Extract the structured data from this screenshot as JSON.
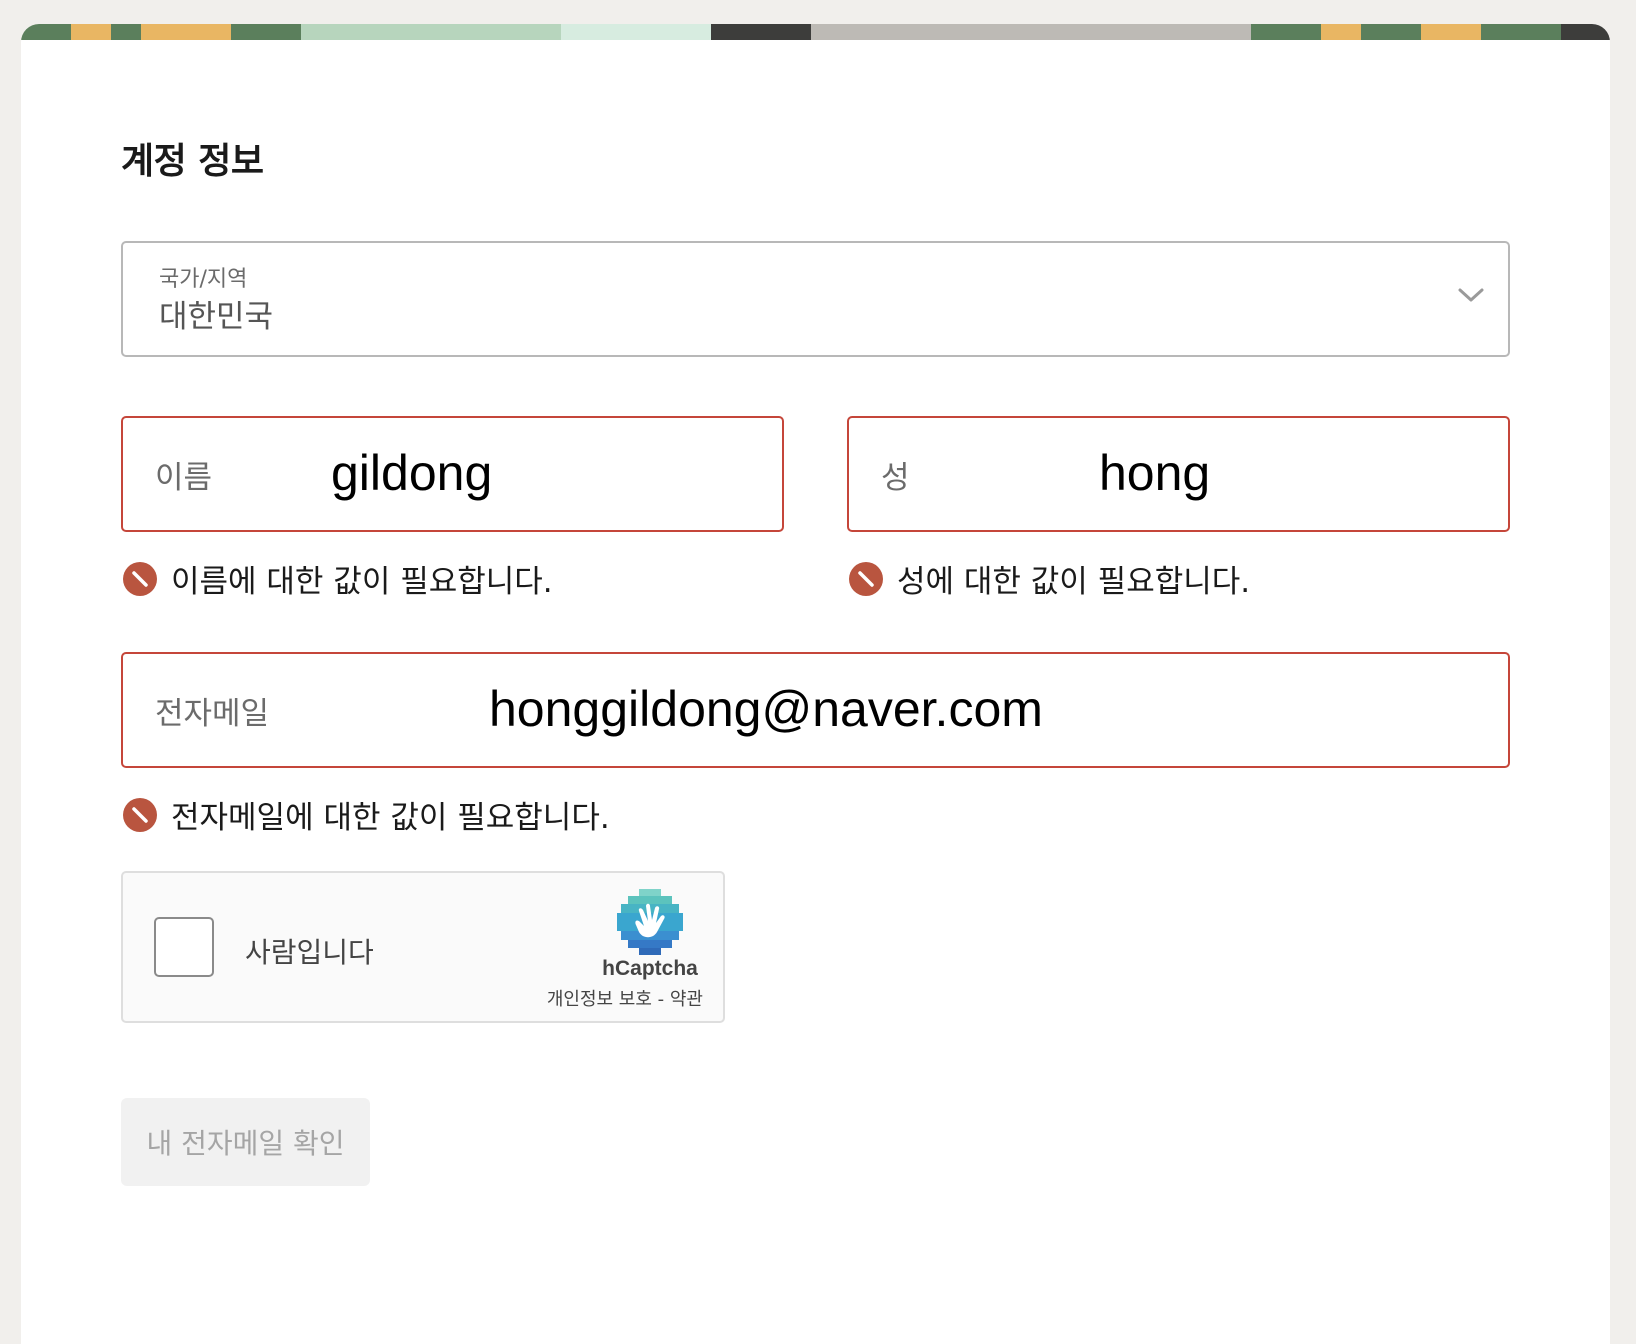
{
  "form": {
    "title": "계정 정보",
    "country": {
      "label": "국가/지역",
      "value": "대한민국"
    },
    "first_name": {
      "label": "이름",
      "value": "gildong",
      "error": "이름에 대한 값이 필요합니다."
    },
    "last_name": {
      "label": "성",
      "value": "hong",
      "error": "성에 대한 값이 필요합니다."
    },
    "email": {
      "label": "전자메일",
      "value": "honggildong@naver.com",
      "error": "전자메일에 대한 값이 필요합니다."
    },
    "captcha": {
      "checkbox_label": "사람입니다",
      "brand": "hCaptcha",
      "privacy_link": "개인정보 보호",
      "separator": " - ",
      "terms_link": "약관"
    },
    "submit_label": "내 전자메일 확인"
  },
  "colors": {
    "error": "#c5463a",
    "error_icon": "#b9553f",
    "border": "#b8b8b8",
    "disabled_bg": "#f1f1f1",
    "disabled_text": "#a5a5a5"
  },
  "icons": {
    "select": "chevron-down-icon",
    "error": "no-entry-icon",
    "captcha": "hcaptcha-hand-icon"
  }
}
